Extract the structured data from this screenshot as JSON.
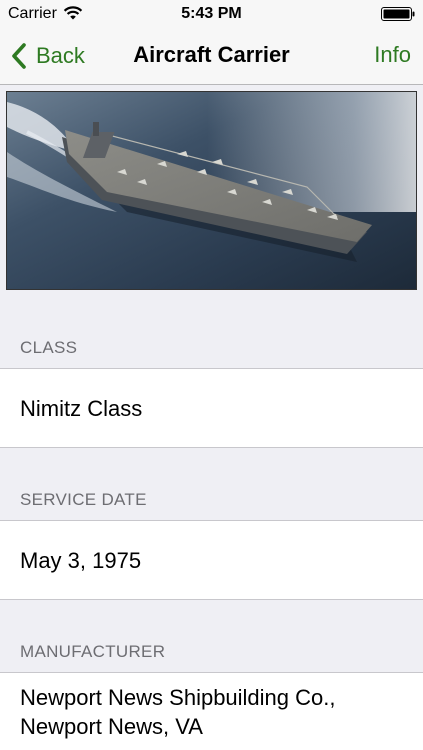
{
  "status_bar": {
    "carrier": "Carrier",
    "time": "5:43 PM"
  },
  "nav": {
    "back_label": "Back",
    "title": "Aircraft Carrier",
    "info_label": "Info"
  },
  "hero": {
    "subject": "aircraft carrier at sea"
  },
  "sections": [
    {
      "header": "CLASS",
      "value": "Nimitz Class"
    },
    {
      "header": "SERVICE DATE",
      "value": "May 3, 1975"
    },
    {
      "header": "MANUFACTURER",
      "value_lines": [
        "Newport News Shipbuilding Co.,",
        "Newport News, VA"
      ]
    }
  ],
  "colors": {
    "accent": "#2e7a22",
    "background": "#efeff4",
    "section_header_text": "#6d6d72"
  }
}
